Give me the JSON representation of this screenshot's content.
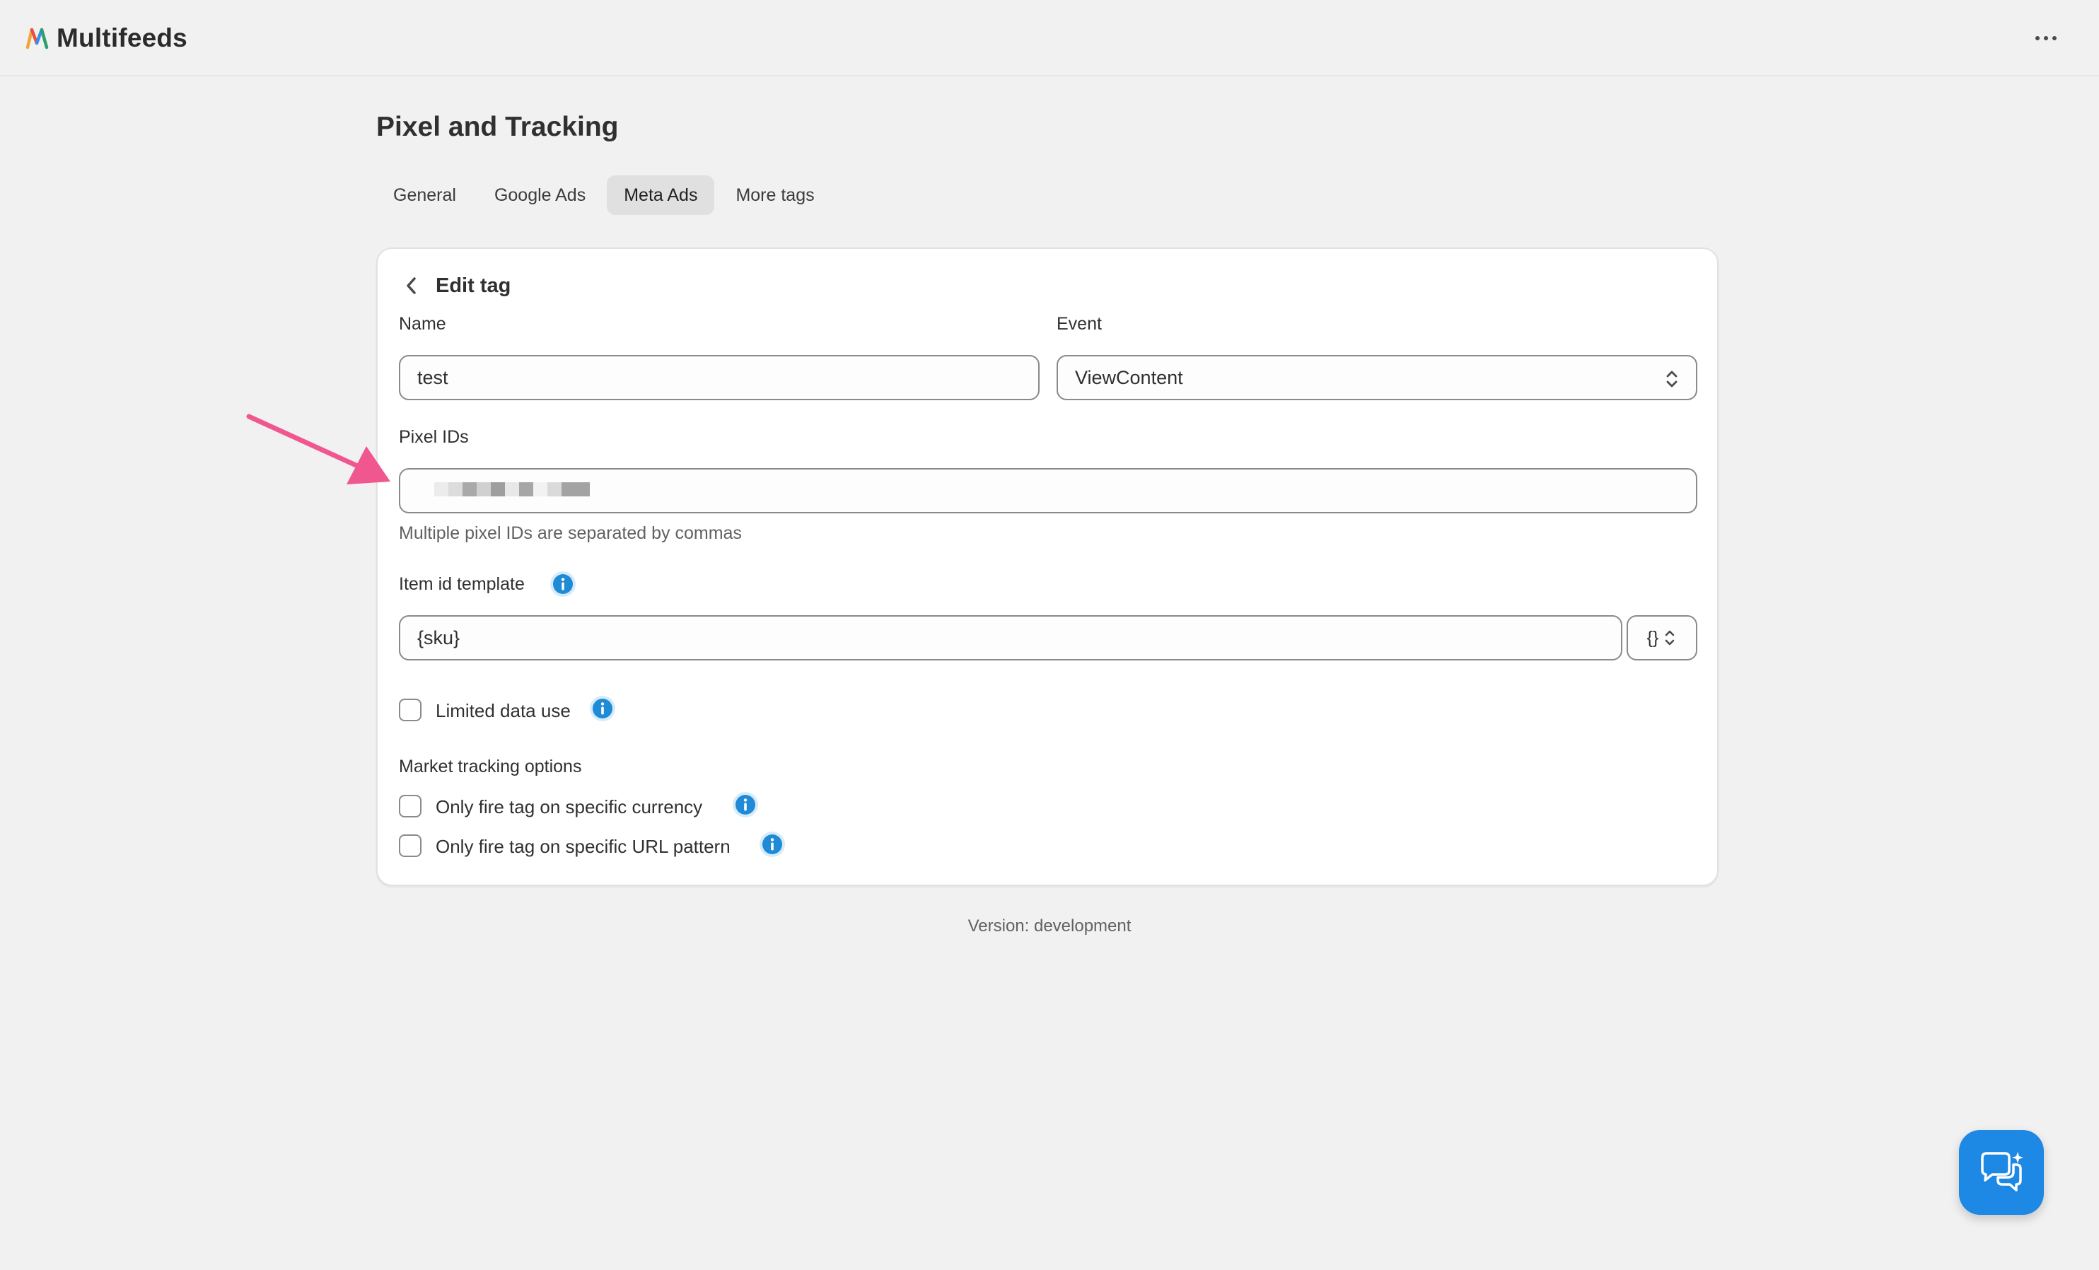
{
  "app": {
    "name": "Multifeeds",
    "more_icon": "more-horizontal-icon"
  },
  "page": {
    "title": "Pixel and Tracking"
  },
  "tabs": [
    {
      "label": "General",
      "active": false
    },
    {
      "label": "Google Ads",
      "active": false
    },
    {
      "label": "Meta Ads",
      "active": true
    },
    {
      "label": "More tags",
      "active": false
    }
  ],
  "card": {
    "title": "Edit tag",
    "name": {
      "label": "Name",
      "value": "test"
    },
    "event": {
      "label": "Event",
      "value": "ViewContent"
    },
    "pixel_ids": {
      "label": "Pixel IDs",
      "help": "Multiple pixel IDs are separated by commas"
    },
    "item_id_template": {
      "label": "Item id template",
      "value": "{sku}",
      "variable_button": "{}"
    },
    "limited_data_use": {
      "label": "Limited data use",
      "checked": false
    },
    "market_tracking": {
      "label": "Market tracking options",
      "options": [
        {
          "label": "Only fire tag on specific currency",
          "checked": false
        },
        {
          "label": "Only fire tag on specific URL pattern",
          "checked": false
        }
      ]
    }
  },
  "footer": {
    "version": "Version: development"
  },
  "colors": {
    "accent_info": "#1f8ad6",
    "arrow": "#f0578f",
    "chat_button": "#1e88e5"
  }
}
